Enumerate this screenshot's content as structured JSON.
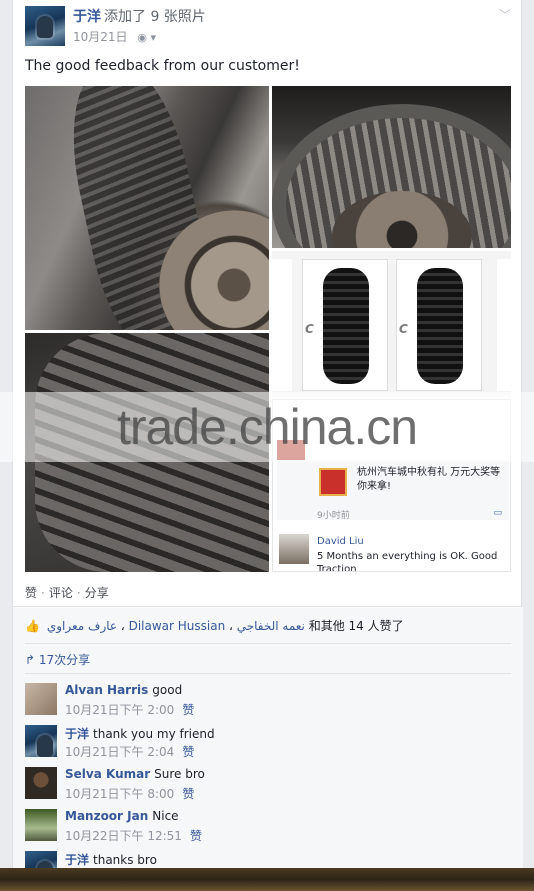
{
  "post": {
    "author": "于洋",
    "action": "添加了 9 张照片",
    "date": "10月21日",
    "privacy_icon": "globe-icon",
    "text": "The good feedback from our customer!"
  },
  "photos": {
    "p3_brand_a": "C",
    "p3_brand_b": "C",
    "p5": {
      "notification_text": "杭州汽车城中秋有礼 万元大奖等你来拿!",
      "notification_time": "9小时前",
      "chat_author": "David Liu",
      "chat_message": "5 Months an everything is OK.  Good Traction"
    }
  },
  "watermark": "trade.china.cn",
  "actions": {
    "like": "赞",
    "comment": "评论",
    "share": "分享"
  },
  "likes": {
    "names": [
      "عارف معراوي",
      "Dilawar Hussian",
      "نعمه الخفاجي"
    ],
    "suffix": "和其他 14 人赞了"
  },
  "shares": "17次分享",
  "comments": [
    {
      "name": "Alvan Harris",
      "text": "good",
      "time": "10月21日下午 2:00",
      "like": "赞"
    },
    {
      "name": "于洋",
      "text": "thank you my friend",
      "time": "10月21日下午 2:04",
      "like": "赞"
    },
    {
      "name": "Selva Kumar",
      "text": "Sure bro",
      "time": "10月21日下午 8:00",
      "like": "赞"
    },
    {
      "name": "Manzoor Jan",
      "text": "Nice",
      "time": "10月22日下午 12:51",
      "like": "赞"
    },
    {
      "name": "于洋",
      "text": "thanks bro",
      "time": "",
      "like": ""
    }
  ]
}
